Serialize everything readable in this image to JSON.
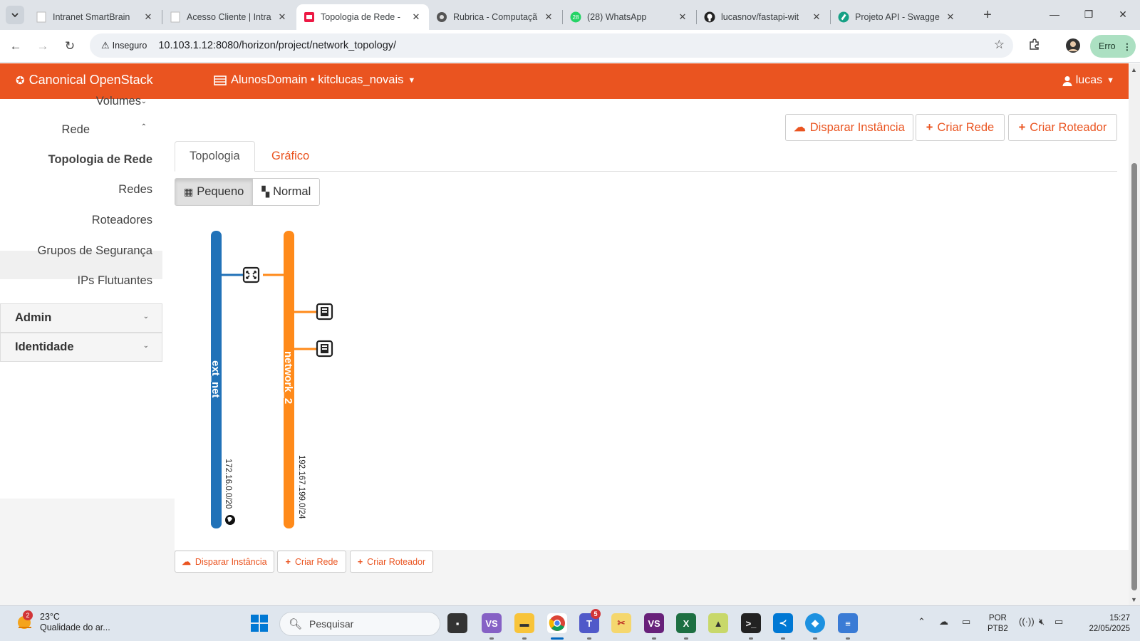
{
  "browser": {
    "tabs": [
      {
        "title": "Intranet SmartBrain",
        "active": false
      },
      {
        "title": "Acesso Cliente | Intra",
        "active": false
      },
      {
        "title": "Topologia de Rede - ",
        "active": true
      },
      {
        "title": "Rubrica - Computaçã",
        "active": false
      },
      {
        "title": "(28) WhatsApp",
        "active": false
      },
      {
        "title": "lucasnov/fastapi-wit",
        "active": false
      },
      {
        "title": "Projeto API - Swagge",
        "active": false
      }
    ],
    "whatsapp_badge": "28",
    "security_label": "Inseguro",
    "url": "10.103.1.12:8080/horizon/project/network_topology/",
    "profile_label": "Erro"
  },
  "header": {
    "brand": "Canonical OpenStack",
    "project": "AlunosDomain • kitclucas_novais",
    "user": "lucas"
  },
  "sidebar": {
    "items": [
      {
        "label": "Volumes",
        "caret": "down"
      },
      {
        "label": "Rede",
        "caret": "up"
      },
      {
        "label": "Topologia de Rede",
        "active": true
      },
      {
        "label": "Redes"
      },
      {
        "label": "Roteadores"
      },
      {
        "label": "Grupos de Segurança"
      },
      {
        "label": "IPs Flutuantes"
      }
    ],
    "sections": [
      {
        "label": "Admin"
      },
      {
        "label": "Identidade"
      }
    ]
  },
  "actions": {
    "launch_instance": "Disparar Instância",
    "create_network": "Criar Rede",
    "create_router": "Criar Roteador"
  },
  "tabs": [
    {
      "label": "Topologia",
      "active": true
    },
    {
      "label": "Gráfico",
      "active": false
    }
  ],
  "size_toggle": {
    "small": "Pequeno",
    "normal": "Normal",
    "selected": "small"
  },
  "topology": {
    "networks": [
      {
        "name": "ext_net",
        "cidr": "172.16.0.0/20",
        "color": "#2172b8",
        "external": true
      },
      {
        "name": "network_2",
        "cidr": "192.167.199.0/24",
        "color": "#ff8a1a",
        "external": false
      }
    ],
    "routers": [
      {
        "connects": [
          "ext_net",
          "network_2"
        ],
        "icon": "router-icon"
      }
    ],
    "instances": [
      {
        "network": "network_2",
        "icon": "instance-icon"
      },
      {
        "network": "network_2",
        "icon": "instance-icon"
      }
    ]
  },
  "colors": {
    "accent": "#ea5420",
    "ext_net": "#2172b8",
    "network_2": "#ff8a1a"
  },
  "taskbar": {
    "weather_temp": "23°C",
    "weather_desc": "Qualidade do ar...",
    "weather_badge": "2",
    "search_placeholder": "Pesquisar",
    "teams_badge": "5",
    "lang_line1": "POR",
    "lang_line2": "PTB2",
    "time": "15:27",
    "date": "22/05/2025"
  }
}
